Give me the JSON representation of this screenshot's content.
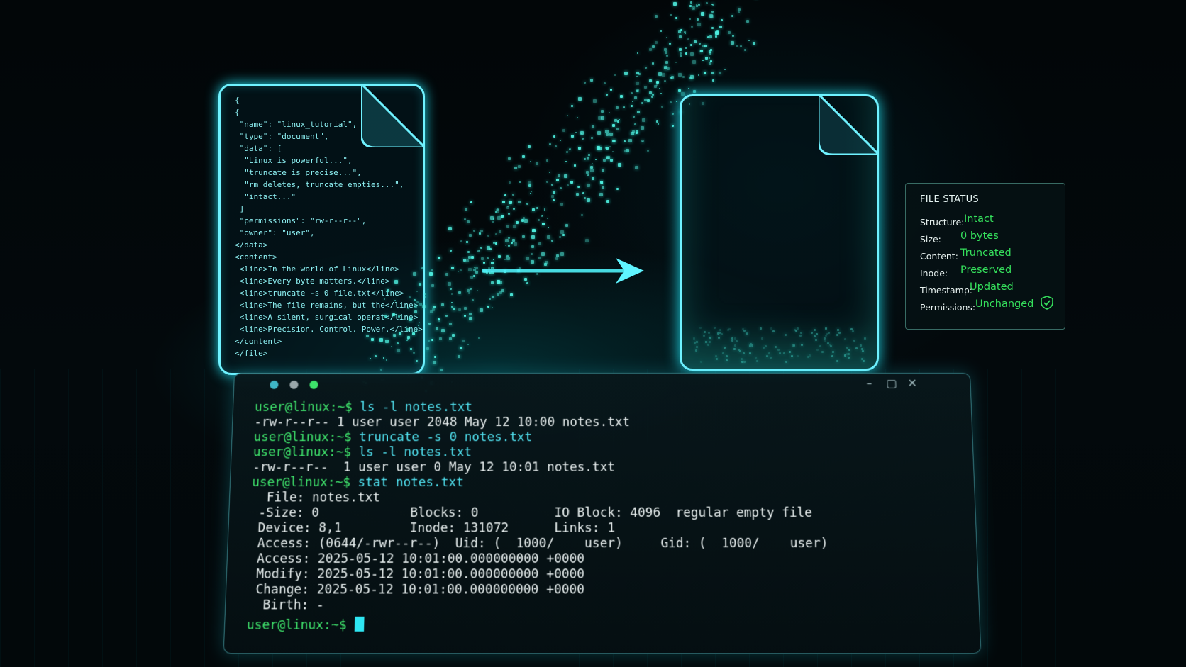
{
  "source_doc": {
    "lines": [
      "{",
      "{",
      " \"name\": \"linux_tutorial\",",
      " \"type\": \"document\",",
      " \"data\": [",
      "  \"Linux is powerful...\",",
      "  \"truncate is precise...\",",
      "  \"rm deletes, truncate empties...\",",
      "  \"intact...\"",
      " ]",
      " \"permissions\": \"rw-r--r--\",",
      " \"owner\": \"user\",",
      "</data>",
      "<content>",
      " <line>In the world of Linux</line>",
      " <line>Every byte matters.</line>",
      " <line>truncate -s 0 file.txt</line>",
      " <line>The file remains, but the</line>",
      " <line>A silent, surgical operat</line>",
      " <line>Precision. Control. Power.</line>",
      "</content>",
      "</file>"
    ]
  },
  "file_status": {
    "title": "FILE STATUS",
    "rows": [
      {
        "key": "Structure:",
        "value": "Intact"
      },
      {
        "key": "Size:",
        "value": "0 bytes"
      },
      {
        "key": "Content:",
        "value": "Truncated"
      },
      {
        "key": "Inode:",
        "value": "Preserved"
      },
      {
        "key": "Timestamp:",
        "value": "Updated"
      },
      {
        "key": "Permissions:",
        "value": "Unchanged"
      }
    ],
    "badge_icon": "shield-check-icon",
    "value_color": "#35e05c"
  },
  "terminal": {
    "dots_colors": [
      "#3fb6c6",
      "#9aa7aa",
      "#3ee36b"
    ],
    "window_controls": [
      "–",
      "▢",
      "✕"
    ],
    "lines": [
      {
        "prompt": "user@linux:~$ ",
        "cmd": "ls -l notes.txt"
      },
      {
        "text": "-rw-r--r-- 1 user user 2048 May 12 10:00 notes.txt"
      },
      {
        "prompt": "user@linux:~$ ",
        "cmd": "truncate -s 0 notes.txt"
      },
      {
        "prompt": "user@linux:~$ ",
        "cmd": "ls -l notes.txt"
      },
      {
        "text": "-rw-r--r--  1 user user 0 May 12 10:01 notes.txt"
      },
      {
        "prompt": "user@linux:~$ ",
        "cmd": "stat notes.txt"
      },
      {
        "text": "  File: notes.txt"
      },
      {
        "text": " -Size: 0            Blocks: 0          IO Block: 4096  regular empty file"
      },
      {
        "text": " Device: 8,1         Inode: 131072      Links: 1"
      },
      {
        "text": " Access: (0644/-rwr--r--)  Uid: (  1000/    user)     Gid: (  1000/    user)"
      },
      {
        "text": " Access: 2025-05-12 10:01:00.000000000 +0000"
      },
      {
        "text": " Modify: 2025-05-12 10:01:00.000000000 +0000"
      },
      {
        "text": " Change: 2025-05-12 10:01:00.000000000 +0000"
      },
      {
        "text": "  Birth: -"
      },
      {
        "prompt": "user@linux:~$ ",
        "cmd": ""
      }
    ]
  }
}
